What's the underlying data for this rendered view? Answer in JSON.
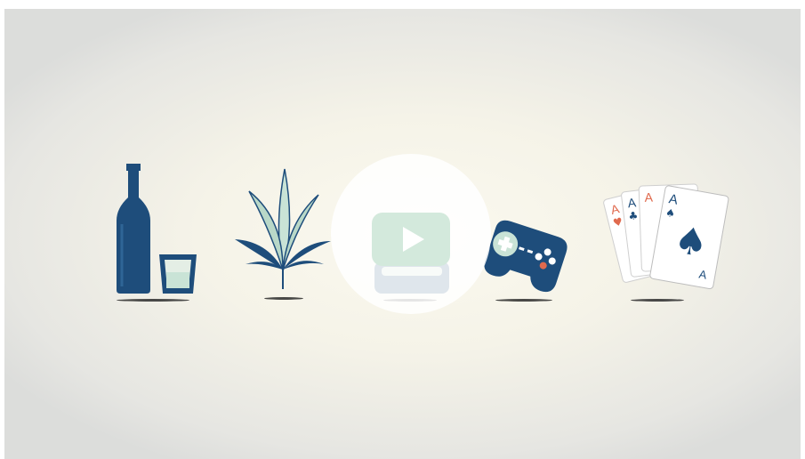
{
  "video": {
    "icons": [
      {
        "name": "bottle-and-glass-icon"
      },
      {
        "name": "cannabis-leaf-icon"
      },
      {
        "name": "dishes-icon"
      },
      {
        "name": "game-controller-icon"
      },
      {
        "name": "playing-cards-icon"
      }
    ],
    "cards": {
      "rank": "A",
      "suit_hearts": "♥",
      "suit_clubs": "♣",
      "suit_spades": "♠"
    },
    "colors": {
      "navy": "#1e4d7b",
      "mint": "#c9e3d6",
      "red_accent": "#e06a4e",
      "background": "#f7f5ea"
    }
  }
}
